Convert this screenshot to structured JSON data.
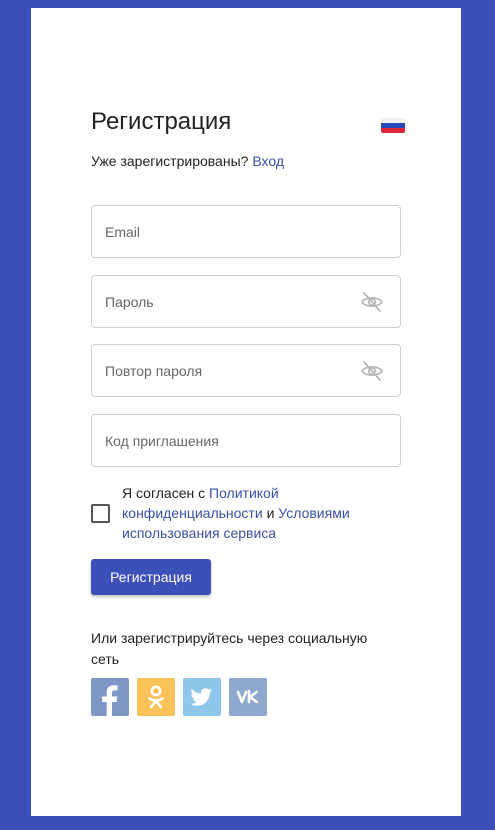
{
  "header": {
    "title": "Регистрация",
    "language_flag": "russia-flag-icon"
  },
  "login_prompt": {
    "text": "Уже зарегистрированы?",
    "link": "Вход"
  },
  "fields": {
    "email": {
      "placeholder": "Email",
      "value": ""
    },
    "password": {
      "placeholder": "Пароль",
      "value": "",
      "icon": "eye-off-icon"
    },
    "password_repeat": {
      "placeholder": "Повтор пароля",
      "value": "",
      "icon": "eye-off-icon"
    },
    "invite_code": {
      "placeholder": "Код приглашения",
      "value": ""
    }
  },
  "agreement": {
    "text_start": "Я согласен с",
    "privacy_link": "Политикой конфиденциальности",
    "conjunction": "и",
    "terms_link": "Условиями использования сервиса",
    "checked": false
  },
  "submit": {
    "label": "Регистрация"
  },
  "social": {
    "text": "Или зарегистрируйтесь через социальную сеть",
    "buttons": [
      {
        "name": "facebook-icon",
        "color": "#7f97c6"
      },
      {
        "name": "odnoklassniki-icon",
        "color": "#fcc25a"
      },
      {
        "name": "twitter-icon",
        "color": "#8ec7ea"
      },
      {
        "name": "vk-icon",
        "color": "#8ea9cd"
      }
    ]
  },
  "colors": {
    "accent": "#3d4fb8",
    "link": "#3a4fa9",
    "background": "#3d4fb8"
  }
}
